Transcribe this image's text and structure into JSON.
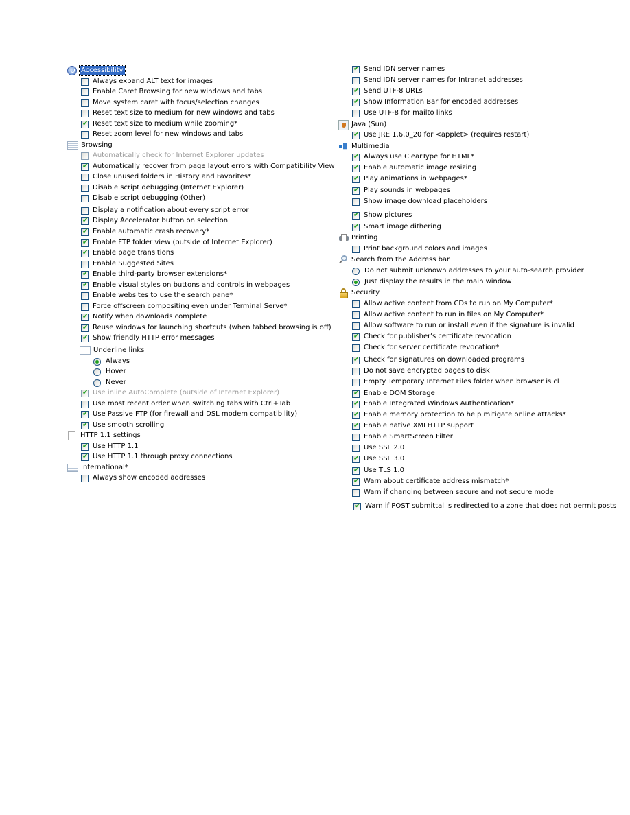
{
  "left_column": [
    {
      "kind": "category",
      "icon": "accessibility-icon",
      "label": "Accessibility",
      "selected": true
    },
    {
      "kind": "checkbox",
      "label": "Always expand ALT text for images",
      "checked": false
    },
    {
      "kind": "checkbox",
      "label": "Enable Caret Browsing for new windows and tabs",
      "checked": false
    },
    {
      "kind": "checkbox",
      "label": "Move system caret with focus/selection changes",
      "checked": false
    },
    {
      "kind": "checkbox",
      "label": "Reset text size to medium for new windows and tabs",
      "checked": false
    },
    {
      "kind": "checkbox",
      "label": "Reset text size to medium while zooming*",
      "checked": true
    },
    {
      "kind": "checkbox",
      "label": "Reset zoom level for new windows and tabs",
      "checked": false
    },
    {
      "kind": "category",
      "icon": "list-settings-icon",
      "label": "Browsing"
    },
    {
      "kind": "checkbox",
      "label": "Automatically check for Internet Explorer updates",
      "checked": false,
      "disabled": true
    },
    {
      "kind": "checkbox",
      "label": "Automatically recover from page layout errors with Compatibility View",
      "checked": true
    },
    {
      "kind": "checkbox",
      "label": "Close unused folders in History and Favorites*",
      "checked": false
    },
    {
      "kind": "checkbox",
      "label": "Disable script debugging (Internet Explorer)",
      "checked": false
    },
    {
      "kind": "checkbox",
      "label": "Disable script debugging (Other)",
      "checked": false
    },
    {
      "kind": "checkbox",
      "label": "Display a notification about every script error",
      "checked": false
    },
    {
      "kind": "checkbox",
      "label": "Display Accelerator button on selection",
      "checked": true
    },
    {
      "kind": "checkbox",
      "label": "Enable automatic crash recovery*",
      "checked": true
    },
    {
      "kind": "checkbox",
      "label": "Enable FTP folder view (outside of Internet Explorer)",
      "checked": true
    },
    {
      "kind": "checkbox",
      "label": "Enable page transitions",
      "checked": true
    },
    {
      "kind": "checkbox",
      "label": "Enable Suggested Sites",
      "checked": false
    },
    {
      "kind": "checkbox",
      "label": "Enable third-party browser extensions*",
      "checked": true
    },
    {
      "kind": "checkbox",
      "label": "Enable visual styles on buttons and controls in webpages",
      "checked": true
    },
    {
      "kind": "checkbox",
      "label": "Enable websites to use the search pane*",
      "checked": false
    },
    {
      "kind": "checkbox",
      "label": "Force offscreen compositing even under Terminal Serve*",
      "checked": false
    },
    {
      "kind": "checkbox",
      "label": "Notify when downloads complete",
      "checked": true
    },
    {
      "kind": "checkbox",
      "label": "Reuse windows for launching shortcuts (when tabbed browsing is off)",
      "checked": true
    },
    {
      "kind": "checkbox",
      "label": "Show friendly HTTP error messages",
      "checked": true
    },
    {
      "kind": "subcategory",
      "icon": "list-settings-icon",
      "label": "Underline links"
    },
    {
      "kind": "radio",
      "label": "Always",
      "checked": true
    },
    {
      "kind": "radio",
      "label": "Hover",
      "checked": false
    },
    {
      "kind": "radio",
      "label": "Never",
      "checked": false
    },
    {
      "kind": "checkbox",
      "label": "Use inline AutoComplete (outside of Internet Explorer)",
      "checked": true,
      "disabled": true
    },
    {
      "kind": "checkbox",
      "label": "Use most recent order when switching tabs with Ctrl+Tab",
      "checked": false
    },
    {
      "kind": "checkbox",
      "label": "Use Passive FTP (for firewall and DSL modem compatibility)",
      "checked": true
    },
    {
      "kind": "checkbox",
      "label": "Use smooth scrolling",
      "checked": true
    },
    {
      "kind": "category",
      "icon": "page-icon",
      "label": "HTTP 1.1 settings"
    },
    {
      "kind": "checkbox",
      "label": "Use HTTP 1.1",
      "checked": true
    },
    {
      "kind": "checkbox",
      "label": "Use HTTP 1.1 through proxy connections",
      "checked": true
    },
    {
      "kind": "category",
      "icon": "list-settings-icon",
      "label": "International*"
    },
    {
      "kind": "checkbox",
      "label": "Always show encoded addresses",
      "checked": false
    }
  ],
  "right_column": [
    {
      "kind": "checkbox",
      "label": "Send IDN server names",
      "checked": true
    },
    {
      "kind": "checkbox",
      "label": "Send IDN server names for Intranet addresses",
      "checked": false
    },
    {
      "kind": "checkbox",
      "label": "Send UTF-8 URLs",
      "checked": true
    },
    {
      "kind": "checkbox",
      "label": "Show Information Bar for encoded addresses",
      "checked": true
    },
    {
      "kind": "checkbox",
      "label": "Use UTF-8 for mailto links",
      "checked": false
    },
    {
      "kind": "category",
      "icon": "java-icon",
      "label": "Java (Sun)"
    },
    {
      "kind": "checkbox",
      "label": "Use JRE 1.6.0_20 for <applet> (requires restart)",
      "checked": true
    },
    {
      "kind": "category",
      "icon": "multimedia-icon",
      "label": "Multimedia"
    },
    {
      "kind": "checkbox",
      "label": "Always use ClearType for HTML*",
      "checked": true
    },
    {
      "kind": "checkbox",
      "label": "Enable automatic image resizing",
      "checked": true
    },
    {
      "kind": "checkbox",
      "label": "Play animations in webpages*",
      "checked": true
    },
    {
      "kind": "checkbox",
      "label": "Play sounds in webpages",
      "checked": true
    },
    {
      "kind": "checkbox",
      "label": "Show image download placeholders",
      "checked": false
    },
    {
      "kind": "checkbox",
      "label": "Show pictures",
      "checked": true
    },
    {
      "kind": "checkbox",
      "label": "Smart image dithering",
      "checked": true
    },
    {
      "kind": "category",
      "icon": "printer-icon",
      "label": "Printing"
    },
    {
      "kind": "checkbox",
      "label": "Print background colors and images",
      "checked": false
    },
    {
      "kind": "category",
      "icon": "search-icon",
      "label": "Search from the Address bar"
    },
    {
      "kind": "radio",
      "label": "Do not submit unknown addresses to your auto-search provider",
      "checked": false
    },
    {
      "kind": "radio",
      "label": "Just display the results in the main window",
      "checked": true
    },
    {
      "kind": "category",
      "icon": "lock-icon",
      "label": "Security"
    },
    {
      "kind": "checkbox",
      "label": "Allow active content from CDs to run on My Computer*",
      "checked": false
    },
    {
      "kind": "checkbox",
      "label": "Allow active content to run in files on My Computer*",
      "checked": false
    },
    {
      "kind": "checkbox",
      "label": "Allow software to run or install even if the signature is invalid",
      "checked": false
    },
    {
      "kind": "checkbox",
      "label": "Check for publisher's certificate revocation",
      "checked": true
    },
    {
      "kind": "checkbox",
      "label": "Check for server certificate revocation*",
      "checked": false
    },
    {
      "kind": "checkbox",
      "label": "Check for signatures on downloaded programs",
      "checked": true
    },
    {
      "kind": "checkbox",
      "label": "Do not save encrypted pages to disk",
      "checked": false
    },
    {
      "kind": "checkbox",
      "label": "Empty Temporary Internet Files folder when browser is cl",
      "checked": false
    },
    {
      "kind": "checkbox",
      "label": "Enable DOM Storage",
      "checked": true
    },
    {
      "kind": "checkbox",
      "label": "Enable Integrated Windows Authentication*",
      "checked": true
    },
    {
      "kind": "checkbox",
      "label": "Enable memory protection to help mitigate online attacks*",
      "checked": true
    },
    {
      "kind": "checkbox",
      "label": "Enable native XMLHTTP support",
      "checked": true
    },
    {
      "kind": "checkbox",
      "label": "Enable SmartScreen Filter",
      "checked": false
    },
    {
      "kind": "checkbox",
      "label": "Use SSL 2.0",
      "checked": false
    },
    {
      "kind": "checkbox",
      "label": "Use SSL 3.0",
      "checked": true
    },
    {
      "kind": "checkbox",
      "label": "Use TLS 1.0",
      "checked": true
    },
    {
      "kind": "checkbox",
      "label": "Warn about certificate address mismatch*",
      "checked": true
    },
    {
      "kind": "checkbox",
      "label": "Warn if changing between secure and not secure mode",
      "checked": false
    },
    {
      "kind": "checkbox",
      "label": "Warn if POST submittal is redirected to a zone that does not permit posts",
      "checked": true
    }
  ],
  "colors": {
    "selection": "#316ac5",
    "checkmark": "#21a121",
    "control_border": "#1c5180",
    "disabled_text": "#9a9a9a"
  }
}
